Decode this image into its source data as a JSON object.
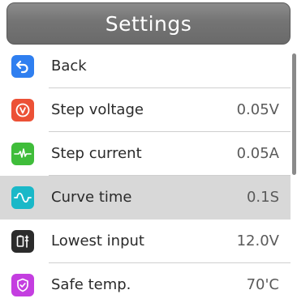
{
  "header": {
    "title": "Settings"
  },
  "menu": {
    "items": [
      {
        "label": "Back",
        "value": "",
        "icon": "back-arrow-icon",
        "color": "#2f7ff0",
        "selected": false
      },
      {
        "label": "Step voltage",
        "value": "0.05V",
        "icon": "voltage-icon",
        "color": "#ec5136",
        "selected": false
      },
      {
        "label": "Step current",
        "value": "0.05A",
        "icon": "pulse-icon",
        "color": "#3fbd3a",
        "selected": false
      },
      {
        "label": "Curve time",
        "value": "0.1S",
        "icon": "curve-icon",
        "color": "#1ab8c8",
        "selected": true
      },
      {
        "label": "Lowest input",
        "value": "12.0V",
        "icon": "battery-icon",
        "color": "#2b2b2b",
        "selected": false
      },
      {
        "label": "Safe temp.",
        "value": "70'C",
        "icon": "shield-icon",
        "color": "#c43ee0",
        "selected": false
      }
    ]
  }
}
